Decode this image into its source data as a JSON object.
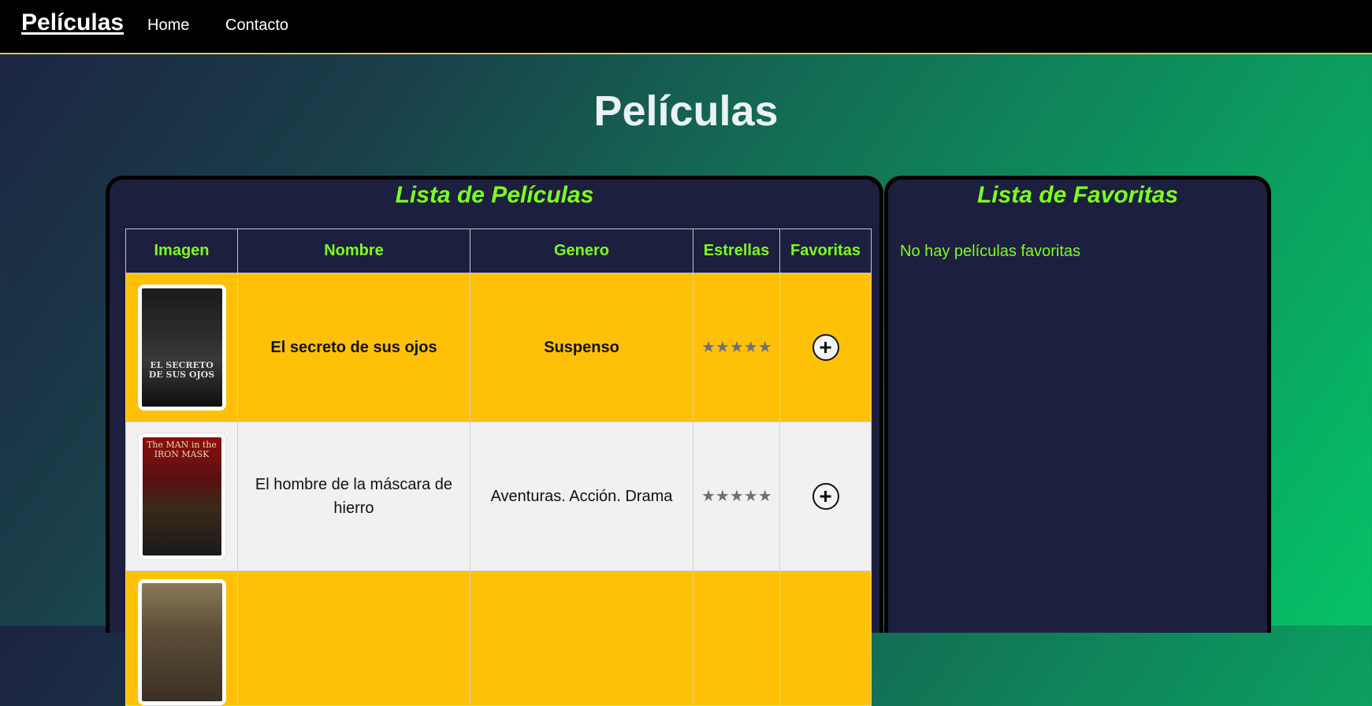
{
  "nav": {
    "brand": "Películas",
    "links": [
      "Home",
      "Contacto"
    ]
  },
  "page_title": "Películas",
  "movies_panel": {
    "title": "Lista de Películas",
    "columns": [
      "Imagen",
      "Nombre",
      "Genero",
      "Estrellas",
      "Favoritas"
    ],
    "rows": [
      {
        "poster_text": "EL SECRETO DE SUS OJOS",
        "name": "El secreto de sus ojos",
        "genre": "Suspenso",
        "stars": "★★★★★",
        "add_icon": "plus-circle-icon",
        "add_label": "+"
      },
      {
        "poster_text": "The MAN in the IRON MASK",
        "name": "El hombre de la máscara de hierro",
        "genre": "Aventuras. Acción. Drama",
        "stars": "★★★★★",
        "add_icon": "plus-circle-icon",
        "add_label": "+"
      },
      {
        "poster_text": "",
        "name": "",
        "genre": "",
        "stars": "",
        "add_icon": "plus-circle-icon",
        "add_label": ""
      }
    ]
  },
  "favorites_panel": {
    "title": "Lista de Favoritas",
    "empty_text": "No hay películas favoritas"
  },
  "colors": {
    "accent_green": "#7cff1f",
    "row_yellow": "#ffc107",
    "row_gray": "#f1f1f1",
    "panel_bg": "#1c1f3d"
  }
}
